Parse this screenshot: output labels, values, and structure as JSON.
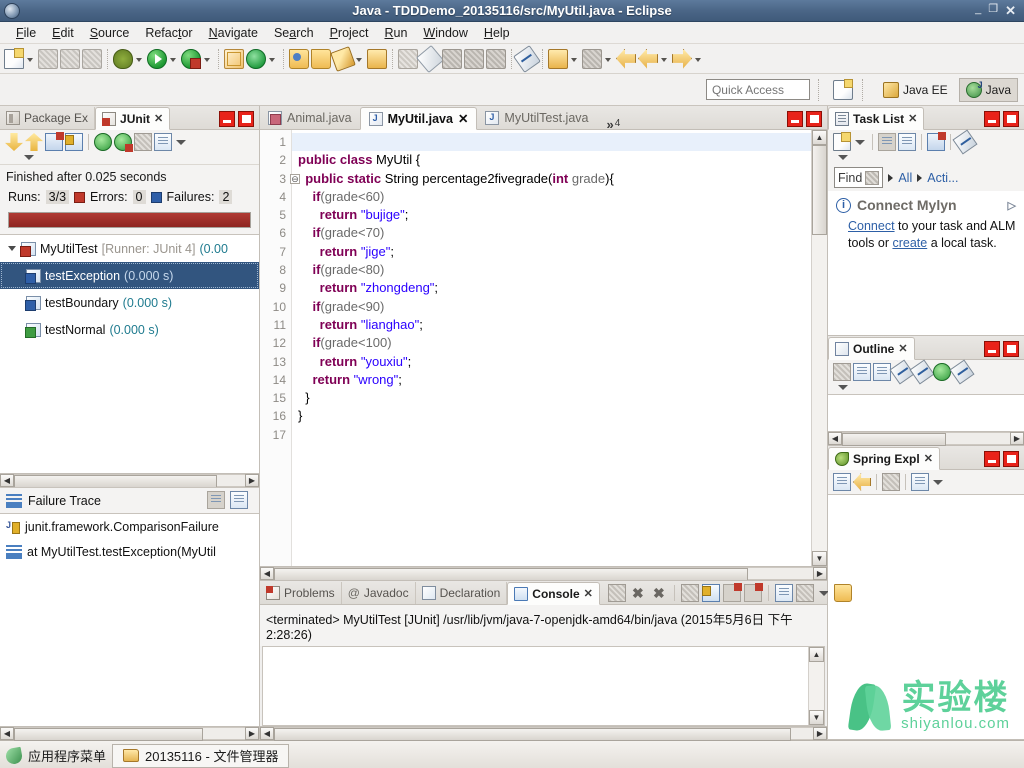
{
  "window": {
    "title": "Java - TDDDemo_20135116/src/MyUtil.java - Eclipse",
    "app_icon": "eclipse-icon",
    "buttons": {
      "minimize": "_",
      "maximize": "❐",
      "close": "✕"
    }
  },
  "menubar": {
    "items": [
      {
        "label": "File",
        "mnemonic": "F"
      },
      {
        "label": "Edit",
        "mnemonic": "E"
      },
      {
        "label": "Source",
        "mnemonic": "S"
      },
      {
        "label": "Refactor",
        "mnemonic": "t"
      },
      {
        "label": "Navigate",
        "mnemonic": "N"
      },
      {
        "label": "Search",
        "mnemonic": "a"
      },
      {
        "label": "Project",
        "mnemonic": "P"
      },
      {
        "label": "Run",
        "mnemonic": "R"
      },
      {
        "label": "Window",
        "mnemonic": "W"
      },
      {
        "label": "Help",
        "mnemonic": "H"
      }
    ]
  },
  "toolbar": {
    "icons": [
      "new-wizard-icon",
      "dropdown-arrow",
      "save-icon",
      "save-all-icon",
      "print-icon",
      "debug-icon",
      "dropdown-arrow",
      "run-icon",
      "dropdown-arrow",
      "run-error-icon",
      "dropdown-arrow",
      "new-package-icon",
      "refresh-icon",
      "dropdown-arrow",
      "open-type-icon",
      "open-resource-icon",
      "edit-icon",
      "dropdown-arrow",
      "search-folder-icon",
      "search-icon",
      "pencil-icon",
      "shield-icon",
      "table-icon",
      "ruler-icon",
      "toggle-markers-icon",
      "annotation-icon",
      "dropdown-arrow",
      "next-annotation-icon",
      "dropdown-arrow",
      "back-history-icon",
      "back-icon",
      "dropdown-arrow",
      "forward-icon",
      "dropdown-arrow"
    ]
  },
  "quick_access": {
    "placeholder": "Quick Access",
    "new_perspective_icon": "new-perspective-icon",
    "perspectives": [
      {
        "label": "Java EE",
        "icon": "javaee-perspective-icon",
        "active": false
      },
      {
        "label": "Java",
        "icon": "java-perspective-icon",
        "active": true
      }
    ]
  },
  "junit_view": {
    "tabs": [
      {
        "label": "Package Ex",
        "icon": "package-explorer-icon",
        "active": false,
        "closable": false
      },
      {
        "label": "JUnit",
        "icon": "junit-icon",
        "active": true,
        "closable": true,
        "close": "✕"
      }
    ],
    "minimize_title": "Minimize",
    "maximize_title": "Maximize",
    "toolbar_icons": [
      "next-failure-icon",
      "previous-failure-icon",
      "show-failures-only-icon",
      "lock-scroll-icon",
      "rerun-test-icon",
      "rerun-failed-tests-icon",
      "history-icon",
      "view-menu-list-icon",
      "dropdown-arrow"
    ],
    "status": "Finished after 0.025 seconds",
    "counts": {
      "runs_label": "Runs:",
      "runs_value": "3/3",
      "errors_label": "Errors:",
      "errors_value": "0",
      "failures_label": "Failures:",
      "failures_value": "2"
    },
    "progress": {
      "percent": 100,
      "color": "#9e2f29"
    },
    "tree": [
      {
        "label": "MyUtilTest",
        "meta": "[Runner: JUnit 4]",
        "time": "(0.00",
        "status": "failed",
        "level": 0,
        "expanded": true,
        "selected": false
      },
      {
        "label": "testException",
        "time": "(0.000 s)",
        "status": "failed",
        "level": 1,
        "selected": true
      },
      {
        "label": "testBoundary",
        "time": "(0.000 s)",
        "status": "failed",
        "level": 1,
        "selected": false
      },
      {
        "label": "testNormal",
        "time": "(0.000 s)",
        "status": "passed",
        "level": 1,
        "selected": false
      }
    ],
    "failure_trace": {
      "title": "Failure Trace",
      "toolbar_icons": [
        "filter-stack-trace-icon",
        "compare-result-icon"
      ],
      "rows": [
        {
          "icon": "exception-icon",
          "text": "junit.framework.ComparisonFailure"
        },
        {
          "icon": "stack-frame-icon",
          "text": "at MyUtilTest.testException(MyUtil"
        }
      ]
    }
  },
  "editor": {
    "tabs": [
      {
        "label": "Animal.java",
        "icon": "java-file-icon",
        "active": false
      },
      {
        "label": "MyUtil.java",
        "icon": "java-file-icon",
        "active": true,
        "close": "✕"
      },
      {
        "label": "MyUtilTest.java",
        "icon": "java-file-icon",
        "active": false
      }
    ],
    "more_tabs": {
      "chevron": "»",
      "count": "4"
    },
    "minimize_title": "Minimize",
    "maximize_title": "Maximize",
    "lines": [
      {
        "n": "1",
        "fold": false,
        "highlight": true,
        "tokens": []
      },
      {
        "n": "2",
        "fold": false,
        "highlight": false,
        "tokens": [
          {
            "t": "public class ",
            "c": "kw"
          },
          {
            "t": "MyUtil {",
            "c": "typ"
          }
        ]
      },
      {
        "n": "3",
        "fold": true,
        "highlight": false,
        "tokens": [
          {
            "t": "  ",
            "c": "typ"
          },
          {
            "t": "public static ",
            "c": "kw"
          },
          {
            "t": "String percentage2fivegrade(",
            "c": "typ"
          },
          {
            "t": "int",
            "c": "kw"
          },
          {
            "t": " grade",
            "c": "var"
          },
          {
            "t": "){",
            "c": "typ"
          }
        ]
      },
      {
        "n": "4",
        "fold": false,
        "highlight": false,
        "tokens": [
          {
            "t": "    ",
            "c": "typ"
          },
          {
            "t": "if",
            "c": "kw"
          },
          {
            "t": "(grade<60)",
            "c": "var"
          }
        ]
      },
      {
        "n": "5",
        "fold": false,
        "highlight": false,
        "tokens": [
          {
            "t": "      ",
            "c": "typ"
          },
          {
            "t": "return ",
            "c": "kw"
          },
          {
            "t": "\"bujige\"",
            "c": "str"
          },
          {
            "t": ";",
            "c": "typ"
          }
        ]
      },
      {
        "n": "6",
        "fold": false,
        "highlight": false,
        "tokens": [
          {
            "t": "    ",
            "c": "typ"
          },
          {
            "t": "if",
            "c": "kw"
          },
          {
            "t": "(grade<70)",
            "c": "var"
          }
        ]
      },
      {
        "n": "7",
        "fold": false,
        "highlight": false,
        "tokens": [
          {
            "t": "      ",
            "c": "typ"
          },
          {
            "t": "return ",
            "c": "kw"
          },
          {
            "t": "\"jige\"",
            "c": "str"
          },
          {
            "t": ";",
            "c": "typ"
          }
        ]
      },
      {
        "n": "8",
        "fold": false,
        "highlight": false,
        "tokens": [
          {
            "t": "    ",
            "c": "typ"
          },
          {
            "t": "if",
            "c": "kw"
          },
          {
            "t": "(grade<80)",
            "c": "var"
          }
        ]
      },
      {
        "n": "9",
        "fold": false,
        "highlight": false,
        "tokens": [
          {
            "t": "      ",
            "c": "typ"
          },
          {
            "t": "return ",
            "c": "kw"
          },
          {
            "t": "\"zhongdeng\"",
            "c": "str"
          },
          {
            "t": ";",
            "c": "typ"
          }
        ]
      },
      {
        "n": "10",
        "fold": false,
        "highlight": false,
        "tokens": [
          {
            "t": "    ",
            "c": "typ"
          },
          {
            "t": "if",
            "c": "kw"
          },
          {
            "t": "(grade<90)",
            "c": "var"
          }
        ]
      },
      {
        "n": "11",
        "fold": false,
        "highlight": false,
        "tokens": [
          {
            "t": "      ",
            "c": "typ"
          },
          {
            "t": "return ",
            "c": "kw"
          },
          {
            "t": "\"lianghao\"",
            "c": "str"
          },
          {
            "t": ";",
            "c": "typ"
          }
        ]
      },
      {
        "n": "12",
        "fold": false,
        "highlight": false,
        "tokens": [
          {
            "t": "    ",
            "c": "typ"
          },
          {
            "t": "if",
            "c": "kw"
          },
          {
            "t": "(grade<100)",
            "c": "var"
          }
        ]
      },
      {
        "n": "13",
        "fold": false,
        "highlight": false,
        "tokens": [
          {
            "t": "      ",
            "c": "typ"
          },
          {
            "t": "return ",
            "c": "kw"
          },
          {
            "t": "\"youxiu\"",
            "c": "str"
          },
          {
            "t": ";",
            "c": "typ"
          }
        ]
      },
      {
        "n": "14",
        "fold": false,
        "highlight": false,
        "tokens": [
          {
            "t": "    ",
            "c": "typ"
          },
          {
            "t": "return ",
            "c": "kw"
          },
          {
            "t": "\"wrong\"",
            "c": "str"
          },
          {
            "t": ";",
            "c": "typ"
          }
        ]
      },
      {
        "n": "15",
        "fold": false,
        "highlight": false,
        "tokens": [
          {
            "t": "  }",
            "c": "typ"
          }
        ]
      },
      {
        "n": "16",
        "fold": false,
        "highlight": false,
        "tokens": [
          {
            "t": "}",
            "c": "typ"
          }
        ]
      },
      {
        "n": "17",
        "fold": false,
        "highlight": false,
        "tokens": []
      }
    ]
  },
  "console_view": {
    "tabs": [
      {
        "label": "Problems",
        "icon": "problems-icon",
        "active": false
      },
      {
        "label": "Javadoc",
        "icon": "javadoc-icon",
        "active": false
      },
      {
        "label": "Declaration",
        "icon": "declaration-icon",
        "active": false
      },
      {
        "label": "Console",
        "icon": "console-icon",
        "active": true,
        "close": "✕"
      }
    ],
    "toolbar_icons": [
      "terminate-icon",
      "remove-launch-icon",
      "remove-all-launches-icon",
      "clear-console-icon",
      "scroll-lock-icon",
      "show-console-on-output-icon",
      "show-console-on-error-icon",
      "pin-console-icon",
      "display-selected-console-icon",
      "dropdown-arrow",
      "open-console-icon",
      "dropdown-arrow"
    ],
    "minimize_title": "Minimize",
    "maximize_title": "Maximize",
    "output": "<terminated> MyUtilTest [JUnit] /usr/lib/jvm/java-7-openjdk-amd64/bin/java (2015年5月6日 下午2:28:26)"
  },
  "task_list": {
    "tab": {
      "label": "Task List",
      "icon": "task-list-icon",
      "close": "✕"
    },
    "toolbar_icons": [
      "new-task-icon",
      "dropdown-arrow",
      "categorized-mode-icon",
      "scheduled-mode-icon",
      "synchronize-icon",
      "focus-icon",
      "dropdown-arrow"
    ],
    "find": {
      "label": "Find",
      "icon": "find-filter-icon"
    },
    "filters": [
      {
        "label": "All"
      },
      {
        "label": "Acti..."
      }
    ],
    "connect_mylyn": {
      "title": "Connect Mylyn",
      "info_icon": "info-icon",
      "link_connect": "Connect",
      "text_middle": " to your task and ALM tools or ",
      "link_create": "create",
      "text_end": " a local task."
    }
  },
  "outline_view": {
    "tab": {
      "label": "Outline",
      "icon": "outline-icon",
      "close": "✕"
    },
    "toolbar_icons": [
      "collapse-all-icon",
      "hide-fields-icon",
      "sort-icon",
      "hide-static-icon",
      "hide-nonpublic-icon",
      "green-dot-icon",
      "hide-local-types-icon",
      "dropdown-arrow"
    ]
  },
  "spring_explorer": {
    "tab": {
      "label": "Spring Expl",
      "icon": "spring-icon",
      "close": "✕"
    },
    "toolbar_icons": [
      "collapse-all-icon",
      "link-editor-icon",
      "filter-icon",
      "sort-icon",
      "dropdown-arrow"
    ]
  },
  "taskbar": {
    "app_menu_icon": "app-menu-leaf-icon",
    "app_menu_label": "应用程序菜单",
    "window_button": {
      "icon": "folder-icon",
      "label": "20135116 - 文件管理器"
    }
  },
  "watermark": {
    "cn": "实验楼",
    "en": "shiyanlou.com",
    "color": "#5ed19a"
  }
}
